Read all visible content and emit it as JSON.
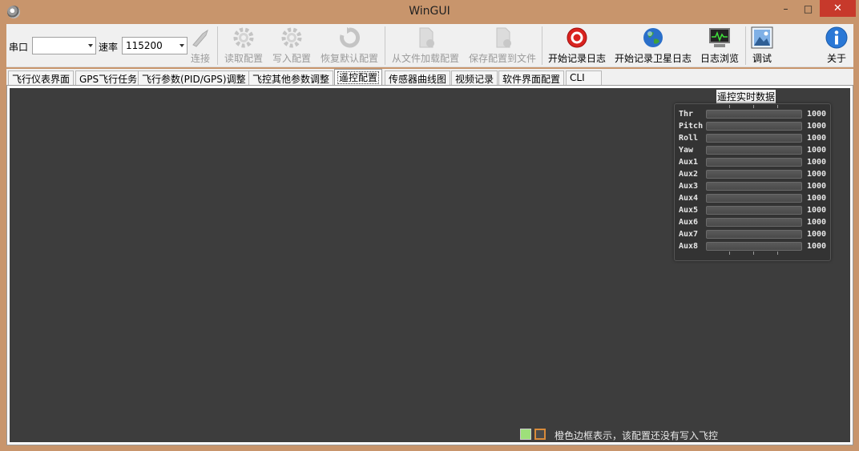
{
  "window": {
    "title": "WinGUI",
    "min": "–",
    "max": "□",
    "close": "✕"
  },
  "toolbar": {
    "port_label": "串口",
    "port_value": "",
    "baud_label": "速率",
    "baud_value": "115200",
    "buttons": {
      "connect": "连接",
      "read_config": "读取配置",
      "write_config": "写入配置",
      "restore_default": "恢复默认配置",
      "load_from_file": "从文件加载配置",
      "save_to_file": "保存配置到文件",
      "start_log": "开始记录日志",
      "start_sat_log": "开始记录卫星日志",
      "log_browse": "日志浏览",
      "debug": "调试",
      "about": "关于"
    }
  },
  "tabs": [
    "飞行仪表界面",
    "GPS飞行任务",
    "飞行参数(PID/GPS)调整",
    "飞控其他参数调整",
    "遥控配置",
    "传感器曲线图",
    "视频记录",
    "软件界面配置",
    "CLI"
  ],
  "rc": {
    "title": "遥控实时数据",
    "channels": [
      {
        "name": "Thr",
        "value": "1000"
      },
      {
        "name": "Pitch",
        "value": "1000"
      },
      {
        "name": "Roll",
        "value": "1000"
      },
      {
        "name": "Yaw",
        "value": "1000"
      },
      {
        "name": "Aux1",
        "value": "1000"
      },
      {
        "name": "Aux2",
        "value": "1000"
      },
      {
        "name": "Aux3",
        "value": "1000"
      },
      {
        "name": "Aux4",
        "value": "1000"
      },
      {
        "name": "Aux5",
        "value": "1000"
      },
      {
        "name": "Aux6",
        "value": "1000"
      },
      {
        "name": "Aux7",
        "value": "1000"
      },
      {
        "name": "Aux8",
        "value": "1000"
      }
    ]
  },
  "legend": {
    "text": "橙色边框表示，该配置还没有写入飞控"
  },
  "colors": {
    "panel": "#3d3d3d",
    "frame": "#c8956c",
    "legend_green": "#9ee07a",
    "legend_orange": "#d98b3a"
  }
}
